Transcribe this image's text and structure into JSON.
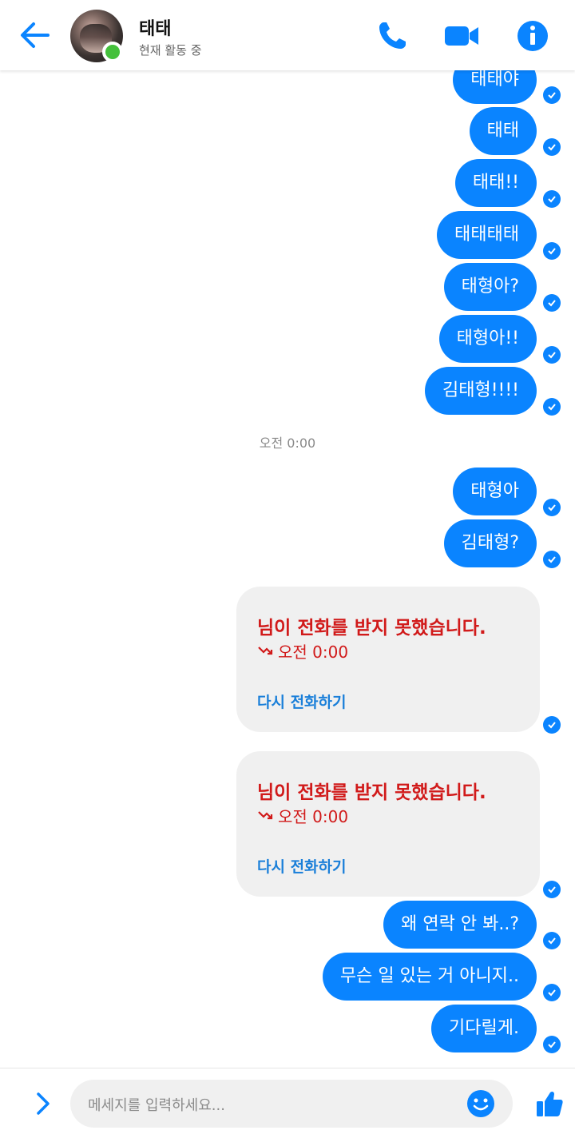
{
  "header": {
    "name": "태태",
    "status": "현재 활동 중",
    "accent": "#0a84ff",
    "icons": [
      "back-arrow-icon",
      "phone-icon",
      "video-camera-icon",
      "info-icon"
    ]
  },
  "messages_top": [
    {
      "text": "태태야"
    },
    {
      "text": "태태"
    },
    {
      "text": "태태!!"
    },
    {
      "text": "태태태태"
    },
    {
      "text": "태형아?"
    },
    {
      "text": "태형아!!"
    },
    {
      "text": "김태형!!!!"
    }
  ],
  "timestamp": "오전 0:00",
  "messages_mid": [
    {
      "text": "태형아"
    },
    {
      "text": "김태형?"
    }
  ],
  "missed_calls": [
    {
      "title": "님이 전화를 받지 못했습니다.",
      "time": "오전 0:00",
      "action": "다시 전화하기"
    },
    {
      "title": "님이 전화를 받지 못했습니다.",
      "time": "오전 0:00",
      "action": "다시 전화하기"
    }
  ],
  "messages_bottom": [
    {
      "text": "왜 연락 안 봐..?"
    },
    {
      "text": "무슨 일 있는 거 아니지.."
    },
    {
      "text": "기다릴게."
    }
  ],
  "composer": {
    "placeholder": "메세지를 입력하세요..."
  }
}
